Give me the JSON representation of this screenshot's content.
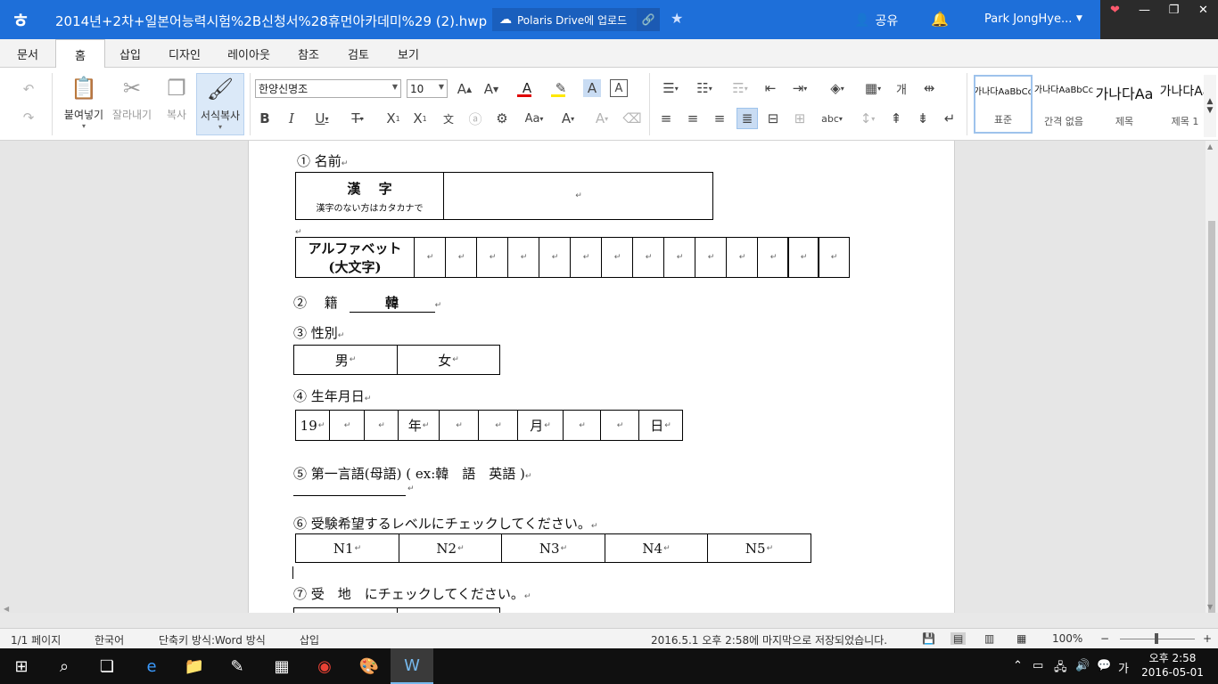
{
  "titlebar": {
    "app_logo": "ㅎ",
    "doc_title": "2014년+2차+일본어능력시험%2B신청서%28휴먼아카데미%29 (2).hwp",
    "polaris_label": "Polaris Drive에 업로드",
    "share_label": "공유",
    "user_name": "Park JongHye..."
  },
  "menu": {
    "tabs": [
      {
        "label": "문서"
      },
      {
        "label": "홈"
      },
      {
        "label": "삽입"
      },
      {
        "label": "디자인"
      },
      {
        "label": "레이아웃"
      },
      {
        "label": "참조"
      },
      {
        "label": "검토"
      },
      {
        "label": "보기"
      }
    ],
    "active_tab": "홈"
  },
  "ribbon": {
    "paste_label": "붙여넣기",
    "cut_label": "잘라내기",
    "copy_label": "복사",
    "format_copy_label": "서식복사",
    "font_name": "한양신명조",
    "font_size": "10",
    "line_label": "개",
    "styles": [
      {
        "sample": "가나다AaBbCc",
        "name": "표준"
      },
      {
        "sample": "가나다AaBbCc",
        "name": "간격 없음"
      },
      {
        "sample": "가나다Aa",
        "name": "제목"
      },
      {
        "sample": "가나다Aa",
        "name": "제목 1"
      }
    ],
    "colors": {
      "font_color": "#e00000",
      "highlight": "#ffe800",
      "accent": "#1e6fd9"
    }
  },
  "document": {
    "item1": "① 名前",
    "kanji_label": "漢　 字",
    "kanji_note": "漢字のない方はカタカナで",
    "alphabet_label": "アルファベット",
    "alphabet_note": "(大文字)",
    "item2_label": "②　 籍",
    "item2_value": "韓",
    "item3": "③ 性別",
    "gender": [
      "男",
      "女"
    ],
    "item4": "④ 生年月日",
    "birth": {
      "century": "19",
      "year": "年",
      "month": "月",
      "day": "日"
    },
    "item5": "⑤ 第一言語(母語) ( ex:韓　語　英語 )",
    "item6": "⑥ 受験希望するレベルにチェックしてください。",
    "levels": [
      "N1",
      "N2",
      "N3",
      "N4",
      "N5"
    ],
    "item7": "⑦ 受　地　にチェックしてください。",
    "para_mark": "↵"
  },
  "statusbar": {
    "page": "1/1 페이지",
    "language": "한국어",
    "shortcut": "단축키 방식:Word 방식",
    "mode": "삽입",
    "saved": "2016.5.1 오후 2:58에 마지막으로 저장되었습니다.",
    "zoom": "100%"
  },
  "taskbar": {
    "time": "오후 2:58",
    "date": "2016-05-01",
    "ime": "가"
  }
}
